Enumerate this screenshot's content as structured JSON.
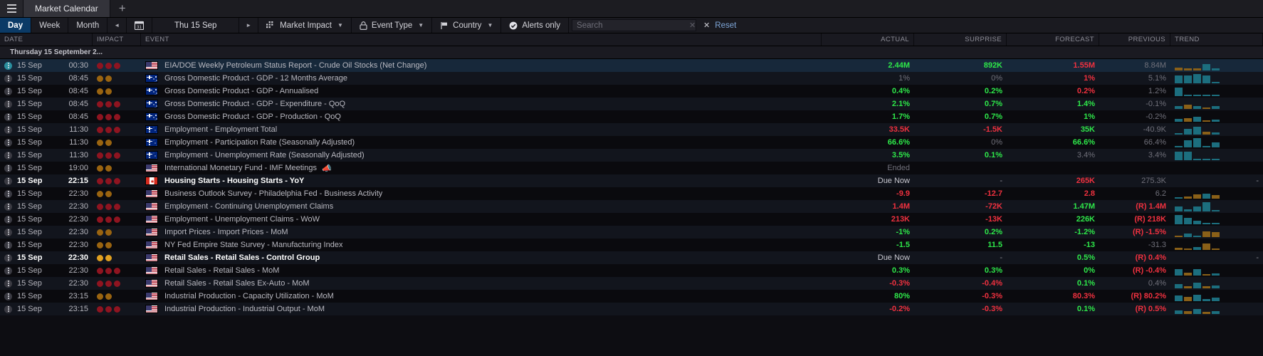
{
  "window": {
    "menu_icon": "hamburger-icon",
    "tab_label": "Market Calendar",
    "new_tab_label": "+"
  },
  "toolbar": {
    "day_label": "Day",
    "week_label": "Week",
    "month_label": "Month",
    "prev_label": "◄",
    "calendar_icon": "calendar-icon",
    "date_label": "Thu 15 Sep",
    "next_label": "►",
    "market_impact_label": "Market Impact",
    "event_type_label": "Event Type",
    "country_label": "Country",
    "alerts_only_label": "Alerts only",
    "search_placeholder": "Search",
    "search_value": "",
    "reset_label": "Reset",
    "accent_active": "#0b3a66",
    "accent_link": "#7ea6d8"
  },
  "table": {
    "columns": [
      "DATE",
      "IMPACT",
      "EVENT",
      "ACTUAL",
      "SURPRISE",
      "FORECAST",
      "PREVIOUS",
      "TREND"
    ],
    "day_group_label": "Thursday 15 September 2...",
    "rows": [
      {
        "date": "15 Sep",
        "time": "00:30",
        "impact": 3,
        "country": "us",
        "event": "EIA/DOE Weekly Petroleum Status Report - Crude Oil Stocks (Net Change)",
        "actual": "2.44M",
        "actual_c": "up",
        "surprise": "892K",
        "surprise_c": "up",
        "forecast": "1.55M",
        "forecast_c": "down",
        "previous": "8.84M",
        "previous_c": "mute",
        "selected": true,
        "bold": false,
        "trend": [
          {
            "h": 4,
            "d": "dn"
          },
          {
            "h": 3,
            "d": "dn"
          },
          {
            "h": 3,
            "d": "dn"
          },
          {
            "h": 9,
            "d": "up"
          },
          {
            "h": 3,
            "d": "up"
          }
        ]
      },
      {
        "date": "15 Sep",
        "time": "08:45",
        "impact": 2,
        "country": "nz",
        "event": "Gross Domestic Product - GDP - 12 Months Average",
        "actual": "1%",
        "actual_c": "mute",
        "surprise": "0%",
        "surprise_c": "mute",
        "forecast": "1%",
        "forecast_c": "down",
        "previous": "5.1%",
        "previous_c": "mute",
        "selected": false,
        "bold": false,
        "trend": [
          {
            "h": 11,
            "d": "up"
          },
          {
            "h": 11,
            "d": "up"
          },
          {
            "h": 13,
            "d": "up"
          },
          {
            "h": 11,
            "d": "up"
          },
          {
            "h": 2,
            "d": "up"
          }
        ]
      },
      {
        "date": "15 Sep",
        "time": "08:45",
        "impact": 2,
        "country": "nz",
        "event": "Gross Domestic Product - GDP - Annualised",
        "actual": "0.4%",
        "actual_c": "up",
        "surprise": "0.2%",
        "surprise_c": "up",
        "forecast": "0.2%",
        "forecast_c": "down",
        "previous": "1.2%",
        "previous_c": "mute",
        "selected": false,
        "bold": false,
        "trend": [
          {
            "h": 12,
            "d": "up"
          },
          {
            "h": 0,
            "d": "up"
          },
          {
            "h": 2,
            "d": "up"
          },
          {
            "h": 2,
            "d": "up"
          },
          {
            "h": 2,
            "d": "up"
          }
        ]
      },
      {
        "date": "15 Sep",
        "time": "08:45",
        "impact": 3,
        "country": "nz",
        "event": "Gross Domestic Product - GDP - Expenditure - QoQ",
        "actual": "2.1%",
        "actual_c": "up",
        "surprise": "0.7%",
        "surprise_c": "up",
        "forecast": "1.4%",
        "forecast_c": "up",
        "previous": "-0.1%",
        "previous_c": "mute",
        "selected": false,
        "bold": false,
        "trend": [
          {
            "h": 4,
            "d": "up"
          },
          {
            "h": 6,
            "d": "dn"
          },
          {
            "h": 4,
            "d": "up"
          },
          {
            "h": 2,
            "d": "dn"
          },
          {
            "h": 4,
            "d": "up"
          }
        ]
      },
      {
        "date": "15 Sep",
        "time": "08:45",
        "impact": 3,
        "country": "nz",
        "event": "Gross Domestic Product - GDP - Production - QoQ",
        "actual": "1.7%",
        "actual_c": "up",
        "surprise": "0.7%",
        "surprise_c": "up",
        "forecast": "1%",
        "forecast_c": "up",
        "previous": "-0.2%",
        "previous_c": "mute",
        "selected": false,
        "bold": false,
        "trend": [
          {
            "h": 4,
            "d": "up"
          },
          {
            "h": 5,
            "d": "dn"
          },
          {
            "h": 7,
            "d": "up"
          },
          {
            "h": 2,
            "d": "dn"
          },
          {
            "h": 3,
            "d": "up"
          }
        ]
      },
      {
        "date": "15 Sep",
        "time": "11:30",
        "impact": 3,
        "country": "au",
        "event": "Employment - Employment Total",
        "actual": "33.5K",
        "actual_c": "down",
        "surprise": "-1.5K",
        "surprise_c": "down",
        "forecast": "35K",
        "forecast_c": "up",
        "previous": "-40.9K",
        "previous_c": "mute",
        "selected": false,
        "bold": false,
        "trend": [
          {
            "h": 2,
            "d": "up"
          },
          {
            "h": 8,
            "d": "up"
          },
          {
            "h": 11,
            "d": "up"
          },
          {
            "h": 4,
            "d": "dn"
          },
          {
            "h": 3,
            "d": "up"
          }
        ]
      },
      {
        "date": "15 Sep",
        "time": "11:30",
        "impact": 2,
        "country": "au",
        "event": "Employment - Participation Rate (Seasonally Adjusted)",
        "actual": "66.6%",
        "actual_c": "up",
        "surprise": "0%",
        "surprise_c": "mute",
        "forecast": "66.6%",
        "forecast_c": "up",
        "previous": "66.4%",
        "previous_c": "mute",
        "selected": false,
        "bold": false,
        "trend": [
          {
            "h": 2,
            "d": "up"
          },
          {
            "h": 10,
            "d": "up"
          },
          {
            "h": 13,
            "d": "up"
          },
          {
            "h": 2,
            "d": "up"
          },
          {
            "h": 7,
            "d": "up"
          }
        ]
      },
      {
        "date": "15 Sep",
        "time": "11:30",
        "impact": 3,
        "country": "au",
        "event": "Employment - Unemployment Rate (Seasonally Adjusted)",
        "actual": "3.5%",
        "actual_c": "up",
        "surprise": "0.1%",
        "surprise_c": "up",
        "forecast": "3.4%",
        "forecast_c": "mute",
        "previous": "3.4%",
        "previous_c": "mute",
        "selected": false,
        "bold": false,
        "trend": [
          {
            "h": 12,
            "d": "up"
          },
          {
            "h": 12,
            "d": "up"
          },
          {
            "h": 2,
            "d": "up"
          },
          {
            "h": 2,
            "d": "up"
          },
          {
            "h": 2,
            "d": "up"
          }
        ]
      },
      {
        "date": "15 Sep",
        "time": "19:00",
        "impact": 2,
        "country": "us",
        "event": "International Monetary Fund - IMF Meetings",
        "megaphone": true,
        "actual": "Ended",
        "actual_c": "mute",
        "surprise": "",
        "surprise_c": "mute",
        "forecast": "",
        "forecast_c": "mute",
        "previous": "",
        "previous_c": "mute",
        "selected": false,
        "bold": false,
        "trend": []
      },
      {
        "date": "15 Sep",
        "time": "22:15",
        "impact": 3,
        "country": "ca",
        "event": "Housing Starts - Housing Starts - YoY",
        "actual": "Due Now",
        "actual_c": "duenow",
        "surprise": "-",
        "surprise_c": "dash",
        "forecast": "265K",
        "forecast_c": "down",
        "previous": "275.3K",
        "previous_c": "mute",
        "selected": false,
        "bold": true,
        "trend": [],
        "trend_dash": true
      },
      {
        "date": "15 Sep",
        "time": "22:30",
        "impact": 2,
        "country": "us",
        "event": "Business Outlook Survey - Philadelphia Fed - Business Activity",
        "actual": "-9.9",
        "actual_c": "down",
        "surprise": "-12.7",
        "surprise_c": "down",
        "forecast": "2.8",
        "forecast_c": "down",
        "previous": "6.2",
        "previous_c": "mute",
        "selected": false,
        "bold": false,
        "trend": [
          {
            "h": 2,
            "d": "up"
          },
          {
            "h": 3,
            "d": "dn"
          },
          {
            "h": 6,
            "d": "dn"
          },
          {
            "h": 7,
            "d": "up"
          },
          {
            "h": 5,
            "d": "dn"
          }
        ]
      },
      {
        "date": "15 Sep",
        "time": "22:30",
        "impact": 3,
        "country": "us",
        "event": "Employment - Continuing Unemployment Claims",
        "actual": "1.4M",
        "actual_c": "down",
        "surprise": "-72K",
        "surprise_c": "down",
        "forecast": "1.47M",
        "forecast_c": "up",
        "previous": "(R) 1.4M",
        "previous_c": "down",
        "selected": false,
        "bold": false,
        "trend": [
          {
            "h": 7,
            "d": "up"
          },
          {
            "h": 3,
            "d": "up"
          },
          {
            "h": 7,
            "d": "up"
          },
          {
            "h": 13,
            "d": "up"
          },
          {
            "h": 2,
            "d": "up"
          }
        ]
      },
      {
        "date": "15 Sep",
        "time": "22:30",
        "impact": 3,
        "country": "us",
        "event": "Employment - Unemployment Claims - WoW",
        "actual": "213K",
        "actual_c": "down",
        "surprise": "-13K",
        "surprise_c": "down",
        "forecast": "226K",
        "forecast_c": "up",
        "previous": "(R) 218K",
        "previous_c": "down",
        "selected": false,
        "bold": false,
        "trend": [
          {
            "h": 13,
            "d": "up"
          },
          {
            "h": 9,
            "d": "up"
          },
          {
            "h": 5,
            "d": "up"
          },
          {
            "h": 2,
            "d": "up"
          },
          {
            "h": 2,
            "d": "up"
          }
        ]
      },
      {
        "date": "15 Sep",
        "time": "22:30",
        "impact": 2,
        "country": "us",
        "event": "Import Prices - Import Prices - MoM",
        "actual": "-1%",
        "actual_c": "up",
        "surprise": "0.2%",
        "surprise_c": "up",
        "forecast": "-1.2%",
        "forecast_c": "up",
        "previous": "(R) -1.5%",
        "previous_c": "down",
        "selected": false,
        "bold": false,
        "trend": [
          {
            "h": 2,
            "d": "dn"
          },
          {
            "h": 5,
            "d": "up"
          },
          {
            "h": 2,
            "d": "up"
          },
          {
            "h": 8,
            "d": "dn"
          },
          {
            "h": 7,
            "d": "dn"
          }
        ]
      },
      {
        "date": "15 Sep",
        "time": "22:30",
        "impact": 2,
        "country": "us",
        "event": "NY Fed Empire State Survey - Manufacturing Index",
        "actual": "-1.5",
        "actual_c": "up",
        "surprise": "11.5",
        "surprise_c": "up",
        "forecast": "-13",
        "forecast_c": "up",
        "previous": "-31.3",
        "previous_c": "mute",
        "selected": false,
        "bold": false,
        "trend": [
          {
            "h": 3,
            "d": "dn"
          },
          {
            "h": 2,
            "d": "dn"
          },
          {
            "h": 4,
            "d": "up"
          },
          {
            "h": 9,
            "d": "dn"
          },
          {
            "h": 2,
            "d": "dn"
          }
        ]
      },
      {
        "date": "15 Sep",
        "time": "22:30",
        "impact": 2,
        "country": "us",
        "event": "Retail Sales - Retail Sales - Control Group",
        "actual": "Due Now",
        "actual_c": "duenow",
        "surprise": "-",
        "surprise_c": "dash",
        "forecast": "0.5%",
        "forecast_c": "up",
        "previous": "(R) 0.4%",
        "previous_c": "down",
        "selected": false,
        "bold": true,
        "trend": [],
        "trend_dash": true
      },
      {
        "date": "15 Sep",
        "time": "22:30",
        "impact": 3,
        "country": "us",
        "event": "Retail Sales - Retail Sales - MoM",
        "actual": "0.3%",
        "actual_c": "up",
        "surprise": "0.3%",
        "surprise_c": "up",
        "forecast": "0%",
        "forecast_c": "up",
        "previous": "(R) -0.4%",
        "previous_c": "down",
        "selected": false,
        "bold": false,
        "trend": [
          {
            "h": 9,
            "d": "up"
          },
          {
            "h": 4,
            "d": "dn"
          },
          {
            "h": 9,
            "d": "up"
          },
          {
            "h": 2,
            "d": "dn"
          },
          {
            "h": 3,
            "d": "up"
          }
        ]
      },
      {
        "date": "15 Sep",
        "time": "22:30",
        "impact": 3,
        "country": "us",
        "event": "Retail Sales - Retail Sales Ex-Auto - MoM",
        "actual": "-0.3%",
        "actual_c": "down",
        "surprise": "-0.4%",
        "surprise_c": "down",
        "forecast": "0.1%",
        "forecast_c": "up",
        "previous": "0.4%",
        "previous_c": "mute",
        "selected": false,
        "bold": false,
        "trend": [
          {
            "h": 6,
            "d": "up"
          },
          {
            "h": 3,
            "d": "dn"
          },
          {
            "h": 8,
            "d": "up"
          },
          {
            "h": 3,
            "d": "dn"
          },
          {
            "h": 4,
            "d": "up"
          }
        ]
      },
      {
        "date": "15 Sep",
        "time": "23:15",
        "impact": 2,
        "country": "us",
        "event": "Industrial Production - Capacity Utilization - MoM",
        "actual": "80%",
        "actual_c": "up",
        "surprise": "-0.3%",
        "surprise_c": "down",
        "forecast": "80.3%",
        "forecast_c": "down",
        "previous": "(R) 80.2%",
        "previous_c": "down",
        "selected": false,
        "bold": false,
        "trend": [
          {
            "h": 8,
            "d": "up"
          },
          {
            "h": 6,
            "d": "dn"
          },
          {
            "h": 9,
            "d": "up"
          },
          {
            "h": 3,
            "d": "up"
          },
          {
            "h": 5,
            "d": "up"
          }
        ]
      },
      {
        "date": "15 Sep",
        "time": "23:15",
        "impact": 3,
        "country": "us",
        "event": "Industrial Production - Industrial Output - MoM",
        "actual": "-0.2%",
        "actual_c": "down",
        "surprise": "-0.3%",
        "surprise_c": "down",
        "forecast": "0.1%",
        "forecast_c": "up",
        "previous": "(R) 0.5%",
        "previous_c": "down",
        "selected": false,
        "bold": false,
        "trend": [
          {
            "h": 5,
            "d": "up"
          },
          {
            "h": 4,
            "d": "dn"
          },
          {
            "h": 7,
            "d": "up"
          },
          {
            "h": 3,
            "d": "dn"
          },
          {
            "h": 4,
            "d": "up"
          }
        ]
      }
    ]
  },
  "colors": {
    "positive": "#2ee84a",
    "negative": "#f0313f",
    "muted": "#70707a",
    "impact_high": "#8f1420",
    "impact_med": "#9a6410",
    "trend_up": "#1c6e7e",
    "trend_down": "#8a6018"
  }
}
